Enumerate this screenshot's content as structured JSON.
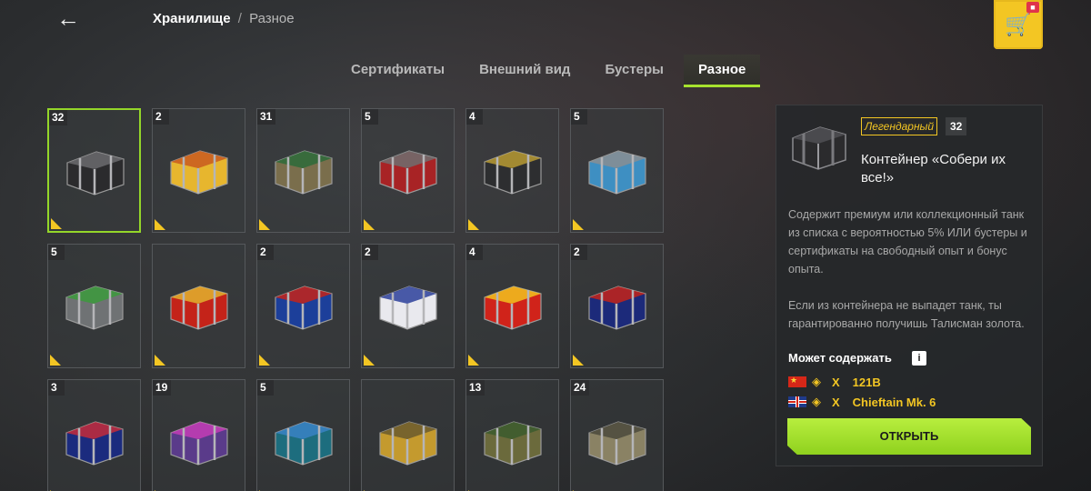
{
  "header": {
    "back_icon": "arrow-left-icon",
    "breadcrumb_main": "Хранилище",
    "breadcrumb_sep": "/",
    "breadcrumb_sub": "Разное"
  },
  "shop": {
    "icon": "shopping-cart-icon",
    "badge_icon": "gift-icon"
  },
  "tabs": [
    {
      "label": "Сертификаты",
      "active": false
    },
    {
      "label": "Внешний вид",
      "active": false
    },
    {
      "label": "Бустеры",
      "active": false
    },
    {
      "label": "Разное",
      "active": true
    }
  ],
  "items": [
    {
      "count": "32",
      "colors": [
        "#2b2b2d",
        "#6b6b6f"
      ]
    },
    {
      "count": "2",
      "colors": [
        "#e7b62e",
        "#c85a1f"
      ]
    },
    {
      "count": "31",
      "colors": [
        "#7a6e4c",
        "#2d6b3a"
      ]
    },
    {
      "count": "5",
      "colors": [
        "#a82325",
        "#6e6e70"
      ]
    },
    {
      "count": "4",
      "colors": [
        "#2d2e30",
        "#b89a32"
      ]
    },
    {
      "count": "5",
      "colors": [
        "#3e8fc2",
        "#8a8e92"
      ]
    },
    {
      "count": "5",
      "colors": [
        "#6f7274",
        "#3c9a3c"
      ]
    },
    {
      "count": "",
      "colors": [
        "#c42319",
        "#e2b22e"
      ]
    },
    {
      "count": "2",
      "colors": [
        "#1c3f9a",
        "#c42319"
      ]
    },
    {
      "count": "2",
      "colors": [
        "#e9e9ee",
        "#2c3f9a"
      ]
    },
    {
      "count": "4",
      "colors": [
        "#d0231a",
        "#f2c21f"
      ]
    },
    {
      "count": "2",
      "colors": [
        "#1c2a7a",
        "#c42319"
      ]
    },
    {
      "count": "3",
      "colors": [
        "#1b2b7e",
        "#c42c3a"
      ]
    },
    {
      "count": "19",
      "colors": [
        "#5a3b8a",
        "#c43db5"
      ]
    },
    {
      "count": "5",
      "colors": [
        "#1d6d7e",
        "#3a82c4"
      ]
    },
    {
      "count": "",
      "colors": [
        "#c49a2e",
        "#6b5a2d"
      ]
    },
    {
      "count": "13",
      "colors": [
        "#6b6a3c",
        "#3b5a2d"
      ]
    },
    {
      "count": "24",
      "colors": [
        "#8a8264",
        "#4b4a3c"
      ]
    }
  ],
  "panel": {
    "rarity": "Легендарный",
    "count": "32",
    "title": "Контейнер «Собери их все!»",
    "desc_1": "Содержит премиум или коллекционный танк из списка с вероятностью 5% ИЛИ бустеры и сертификаты на свободный опыт и бонус опыта.",
    "desc_2": "Если из контейнера не выпадет танк, ты гарантированно получишь Талисман золота.",
    "contains_title": "Может содержать",
    "info_icon": "info-icon",
    "loot": [
      {
        "flag": "china-flag-icon",
        "tier_icon": "tier-x-icon",
        "tier": "X",
        "name": "121B"
      },
      {
        "flag": "uk-flag-icon",
        "tier_icon": "tier-x-icon",
        "tier": "X",
        "name": "Chieftain Mk. 6"
      }
    ],
    "open_label": "ОТКРЫТЬ"
  }
}
